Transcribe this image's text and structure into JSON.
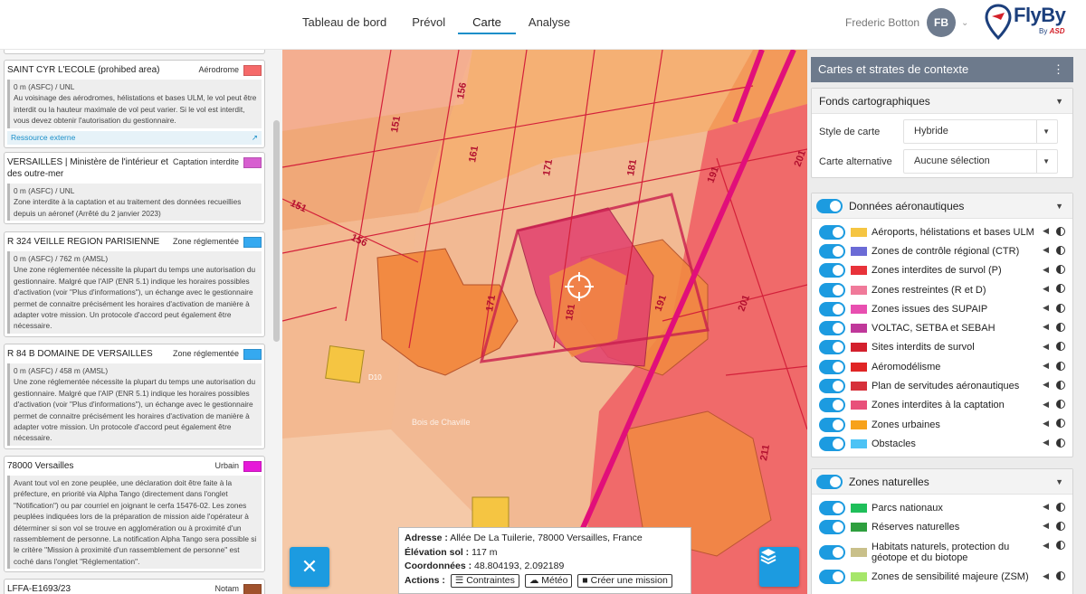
{
  "nav": {
    "tabs": [
      {
        "label": "Tableau de bord"
      },
      {
        "label": "Prévol"
      },
      {
        "label": "Carte"
      },
      {
        "label": "Analyse"
      }
    ]
  },
  "user": {
    "name": "Frederic Botton",
    "initials": "FB"
  },
  "logo": {
    "brand": "FlyBy",
    "by": "By",
    "company": "ASD"
  },
  "zones": [
    {
      "name": "SAINT CYR L'ECOLE (prohibed area)",
      "type": "Aérodrome",
      "color": "#f56a6a",
      "altitude": "0 m (ASFC) / UNL",
      "description": "Au voisinage des aérodromes, hélistations et bases ULM, le vol peut être interdit ou la hauteur maximale de vol peut varier. Si le vol est interdit, vous devez obtenir l'autorisation du gestionnaire.",
      "link": "Ressource externe"
    },
    {
      "name": "VERSAILLES | Ministère de l'intérieur et des outre-mer",
      "type": "Captation interdite",
      "color": "#d75fd0",
      "altitude": "0 m (ASFC) / UNL",
      "description": "Zone interdite à la captation et au traitement des données recueillies depuis un aéronef (Arrêté du 2 janvier 2023)"
    },
    {
      "name": "R 324 VEILLE REGION PARISIENNE",
      "type": "Zone réglementée",
      "color": "#35a9f0",
      "altitude": "0 m (ASFC) / 762 m (AMSL)",
      "description": "Une zone réglementée nécessite la plupart du temps une autorisation du gestionnaire. Malgré que l'AIP (ENR 5.1) indique les horaires possibles d'activation (voir \"Plus d'informations\"), un échange avec le gestionnaire permet de connaitre précisément les horaires d'activation de manière à adapter votre mission. Un protocole d'accord peut également être nécessaire."
    },
    {
      "name": "R 84 B DOMAINE DE VERSAILLES",
      "type": "Zone réglementée",
      "color": "#35a9f0",
      "altitude": "0 m (ASFC) / 458 m (AMSL)",
      "description": "Une zone réglementée nécessite la plupart du temps une autorisation du gestionnaire. Malgré que l'AIP (ENR 5.1) indique les horaires possibles d'activation (voir \"Plus d'informations\"), un échange avec le gestionnaire permet de connaitre précisément les horaires d'activation de manière à adapter votre mission. Un protocole d'accord peut également être nécessaire."
    },
    {
      "name": "78000 Versailles",
      "type": "Urbain",
      "color": "#e619d8",
      "description": "Avant tout vol en zone peuplée, une déclaration doit être faite à la préfecture, en priorité via Alpha Tango (directement dans l'onglet \"Notification\") ou par courriel en joignant le cerfa 15476-02. Les zones peuplées indiquées lors de la préparation de mission aide l'opérateur à déterminer si son vol se trouve en agglomération ou à proximité d'un rassemblement de personne. La notification Alpha Tango sera possible si le critère \"Mission à proximité d'un rassemblement de personne\" est coché dans l'onglet \"Réglementation\"."
    },
    {
      "name": "LFFA-E1693/23",
      "type": "Notam",
      "color": "#a0522d"
    }
  ],
  "map": {
    "labels": [
      "151",
      "156",
      "161",
      "171",
      "181",
      "191",
      "201",
      "151",
      "156",
      "171",
      "181",
      "191",
      "201",
      "211"
    ],
    "road_label": "D10",
    "place_label": "Bois de Chaville"
  },
  "info": {
    "address_label": "Adresse :",
    "address": "Allée De La Tuilerie, 78000 Versailles, France",
    "elevation_label": "Élévation sol :",
    "elevation": "117 m",
    "coords_label": "Coordonnées :",
    "coords": "48.804193, 2.092189",
    "actions_label": "Actions :",
    "actions": [
      "Contraintes",
      "Météo",
      "Créer une mission"
    ]
  },
  "panel": {
    "title": "Cartes et strates de contexte",
    "basemaps": {
      "title": "Fonds cartographiques",
      "style_label": "Style de carte",
      "style_value": "Hybride",
      "alt_label": "Carte alternative",
      "alt_value": "Aucune sélection"
    },
    "aero": {
      "title": "Données aéronautiques",
      "layers": [
        {
          "label": "Aéroports, hélistations et bases ULM",
          "color": "#f5c542"
        },
        {
          "label": "Zones de contrôle régional (CTR)",
          "color": "#6b6bd6"
        },
        {
          "label": "Zones interdites de survol (P)",
          "color": "#e8323a"
        },
        {
          "label": "Zones restreintes (R et D)",
          "color": "#f07a9a"
        },
        {
          "label": "Zones issues des SUPAIP",
          "color": "#e84fb0"
        },
        {
          "label": "VOLTAC, SETBA et SEBAH",
          "color": "#c0389a"
        },
        {
          "label": "Sites interdits de survol",
          "color": "#d3202d"
        },
        {
          "label": "Aéromodélisme",
          "color": "#e02525"
        },
        {
          "label": "Plan de servitudes aéronautiques",
          "color": "#d6303a"
        },
        {
          "label": "Zones interdites à la captation",
          "color": "#e8507a"
        },
        {
          "label": "Zones urbaines",
          "color": "#f7a21b"
        },
        {
          "label": "Obstacles",
          "color": "#4dc3f5"
        }
      ]
    },
    "nature": {
      "title": "Zones naturelles",
      "layers": [
        {
          "label": "Parcs nationaux",
          "color": "#1fbf5a"
        },
        {
          "label": "Réserves naturelles",
          "color": "#2e9f3e"
        },
        {
          "label": "Habitats naturels, protection du géotope et du biotope",
          "color": "#c9c08a"
        },
        {
          "label": "Zones de sensibilité majeure (ZSM)",
          "color": "#a6e66a"
        }
      ]
    }
  }
}
